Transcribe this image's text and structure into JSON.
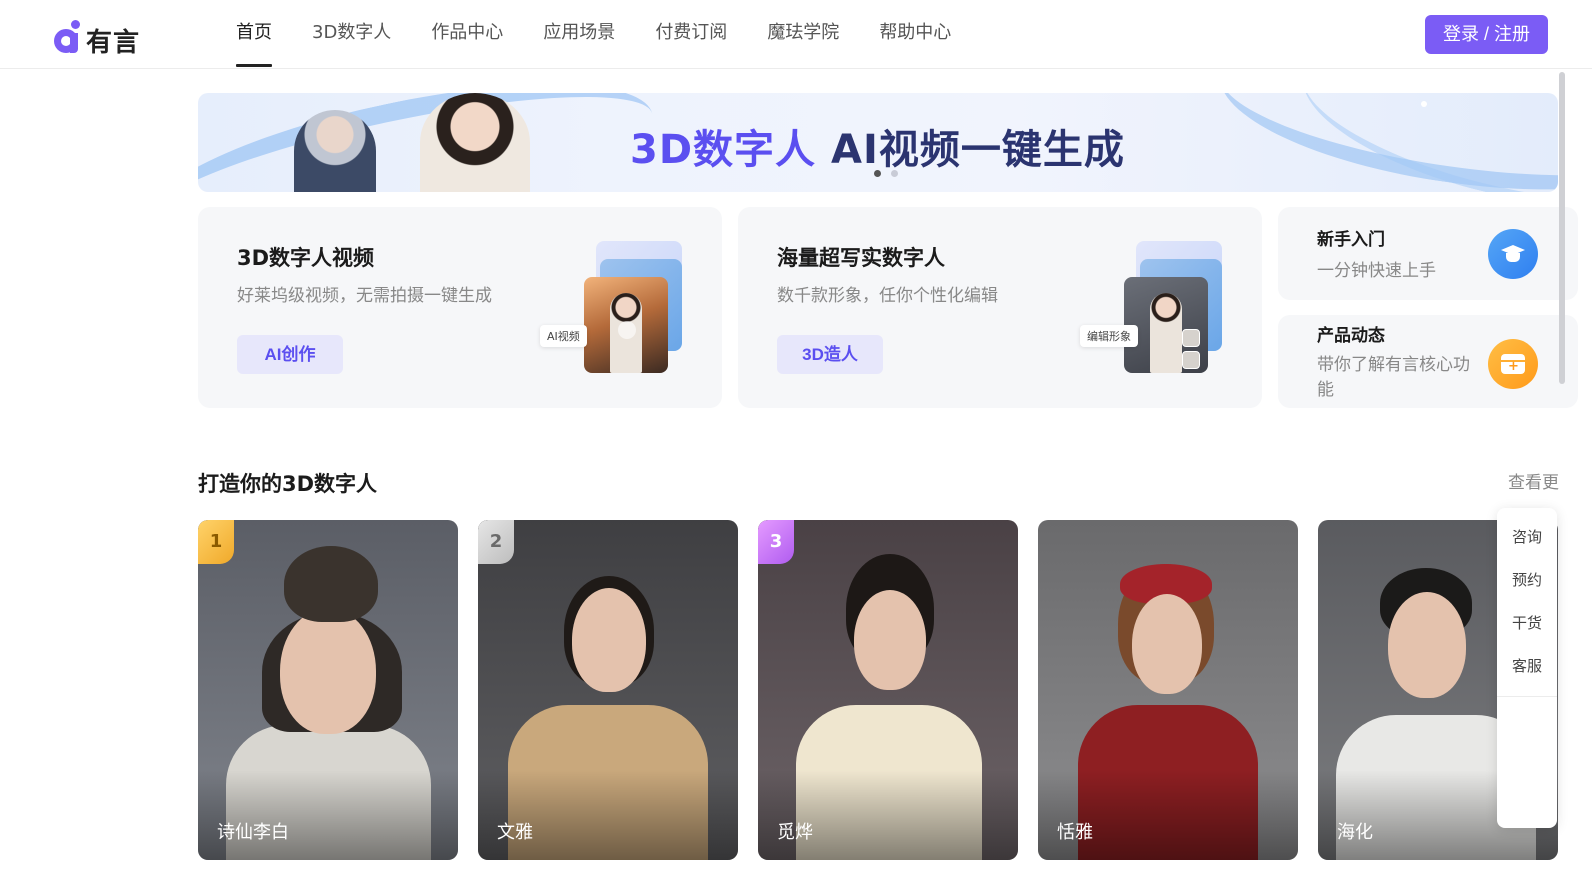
{
  "brand": {
    "name": "有言"
  },
  "nav": {
    "items": [
      {
        "label": "首页",
        "active": true
      },
      {
        "label": "3D数字人",
        "active": false
      },
      {
        "label": "作品中心",
        "active": false
      },
      {
        "label": "应用场景",
        "active": false
      },
      {
        "label": "付费订阅",
        "active": false
      },
      {
        "label": "魔珐学院",
        "active": false
      },
      {
        "label": "帮助中心",
        "active": false
      }
    ],
    "login_label": "登录 / 注册"
  },
  "banner": {
    "title_part1": "3D数字人",
    "title_part2": "AI视频一键生成",
    "slides_total": 2,
    "active_slide": 1
  },
  "features": [
    {
      "title": "3D数字人视频",
      "subtitle": "好莱坞级视频，无需拍摄一键生成",
      "button": "AI创作",
      "tag": "AI视频"
    },
    {
      "title": "海量超写实数字人",
      "subtitle": "数千款形象，任你个性化编辑",
      "button": "3D造人",
      "tag": "编辑形象"
    }
  ],
  "side_cards": [
    {
      "title": "新手入门",
      "subtitle": "一分钟快速上手",
      "icon": "graduation-cap-icon"
    },
    {
      "title": "产品动态",
      "subtitle": "带你了解有言核心功能",
      "icon": "gift-box-icon"
    }
  ],
  "section": {
    "title": "打造你的3D数字人",
    "see_more": "查看更"
  },
  "avatars": [
    {
      "name": "诗仙李白",
      "rank": "1"
    },
    {
      "name": "文雅",
      "rank": "2"
    },
    {
      "name": "觅烨",
      "rank": "3"
    },
    {
      "name": "恬雅",
      "rank": ""
    },
    {
      "name": "海化",
      "rank": ""
    }
  ],
  "float_dock": {
    "items": [
      "咨询",
      "预约",
      "干货",
      "客服"
    ]
  },
  "colors": {
    "accent": "#7b5cf5",
    "feature_button_bg": "#e7e7fb",
    "card_bg": "#f6f7f9"
  }
}
